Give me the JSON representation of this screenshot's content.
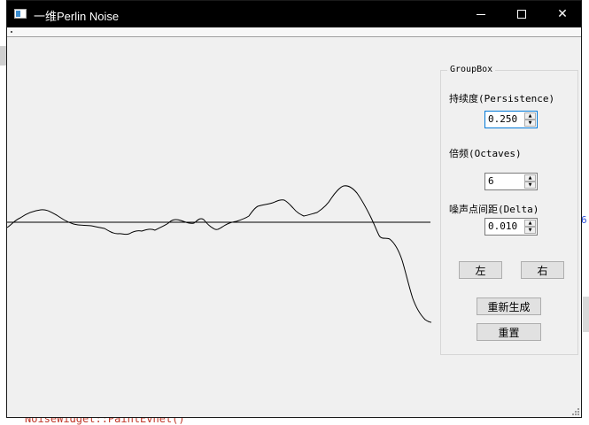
{
  "window": {
    "title": "一维Perlin Noise"
  },
  "title_controls": {
    "minimize": "—",
    "maximize": "☐",
    "close": "✕"
  },
  "group": {
    "title": "GroupBox"
  },
  "persistence": {
    "label": "持续度(Persistence)",
    "value": "0.250"
  },
  "octaves": {
    "label": "倍频(Octaves)",
    "value": "6"
  },
  "delta": {
    "label": "噪声点间距(Delta)",
    "value": "0.010"
  },
  "buttons": {
    "left": "左",
    "right": "右",
    "regenerate": "重新生成",
    "reset": "重置"
  },
  "background": {
    "code_text": "NoiseWidget::PaintEvnet()",
    "digit": "6"
  },
  "icons": [
    "app-icon",
    "minimize-icon",
    "maximize-icon",
    "close-icon",
    "spin-up-icon",
    "spin-down-icon",
    "size-grip-icon"
  ]
}
